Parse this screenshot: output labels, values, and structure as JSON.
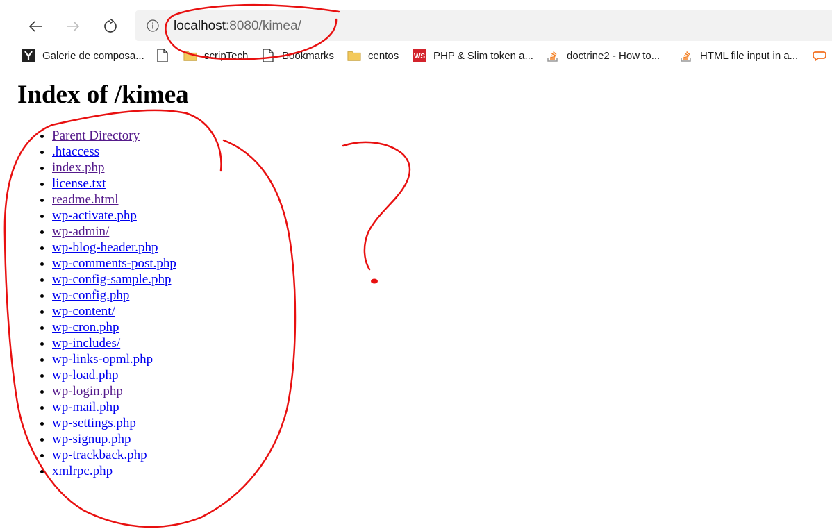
{
  "browser": {
    "url_host": "localhost",
    "url_rest": ":8080/kimea/",
    "bookmarks": [
      {
        "label": "Galerie de composa...",
        "icon": "galerie-favicon"
      },
      {
        "label": "",
        "icon": "page-icon"
      },
      {
        "label": "scripTech",
        "icon": "folder-icon"
      },
      {
        "label": "Bookmarks",
        "icon": "page-icon"
      },
      {
        "label": "centos",
        "icon": "folder-icon"
      },
      {
        "label": "PHP & Slim token a...",
        "icon": "ws-favicon"
      },
      {
        "label": "doctrine2 - How to...",
        "icon": "stackoverflow-icon"
      },
      {
        "label": "HTML file input in a...",
        "icon": "stackoverflow-icon"
      }
    ]
  },
  "page": {
    "title": "Index of /kimea",
    "entries": [
      {
        "name": "Parent Directory",
        "visited": true
      },
      {
        "name": ".htaccess",
        "visited": false
      },
      {
        "name": "index.php",
        "visited": true
      },
      {
        "name": "license.txt",
        "visited": false
      },
      {
        "name": "readme.html",
        "visited": true
      },
      {
        "name": "wp-activate.php",
        "visited": false
      },
      {
        "name": "wp-admin/",
        "visited": true
      },
      {
        "name": "wp-blog-header.php",
        "visited": false
      },
      {
        "name": "wp-comments-post.php",
        "visited": false
      },
      {
        "name": "wp-config-sample.php",
        "visited": false
      },
      {
        "name": "wp-config.php",
        "visited": false
      },
      {
        "name": "wp-content/",
        "visited": false
      },
      {
        "name": "wp-cron.php",
        "visited": false
      },
      {
        "name": "wp-includes/",
        "visited": false
      },
      {
        "name": "wp-links-opml.php",
        "visited": false
      },
      {
        "name": "wp-load.php",
        "visited": false
      },
      {
        "name": "wp-login.php",
        "visited": true
      },
      {
        "name": "wp-mail.php",
        "visited": false
      },
      {
        "name": "wp-settings.php",
        "visited": false
      },
      {
        "name": "wp-signup.php",
        "visited": false
      },
      {
        "name": "wp-trackback.php",
        "visited": false
      },
      {
        "name": "xmlrpc.php",
        "visited": false
      }
    ]
  },
  "colors": {
    "link": "#0000ee",
    "visited_link": "#551a8b",
    "annotation": "#e81010"
  }
}
